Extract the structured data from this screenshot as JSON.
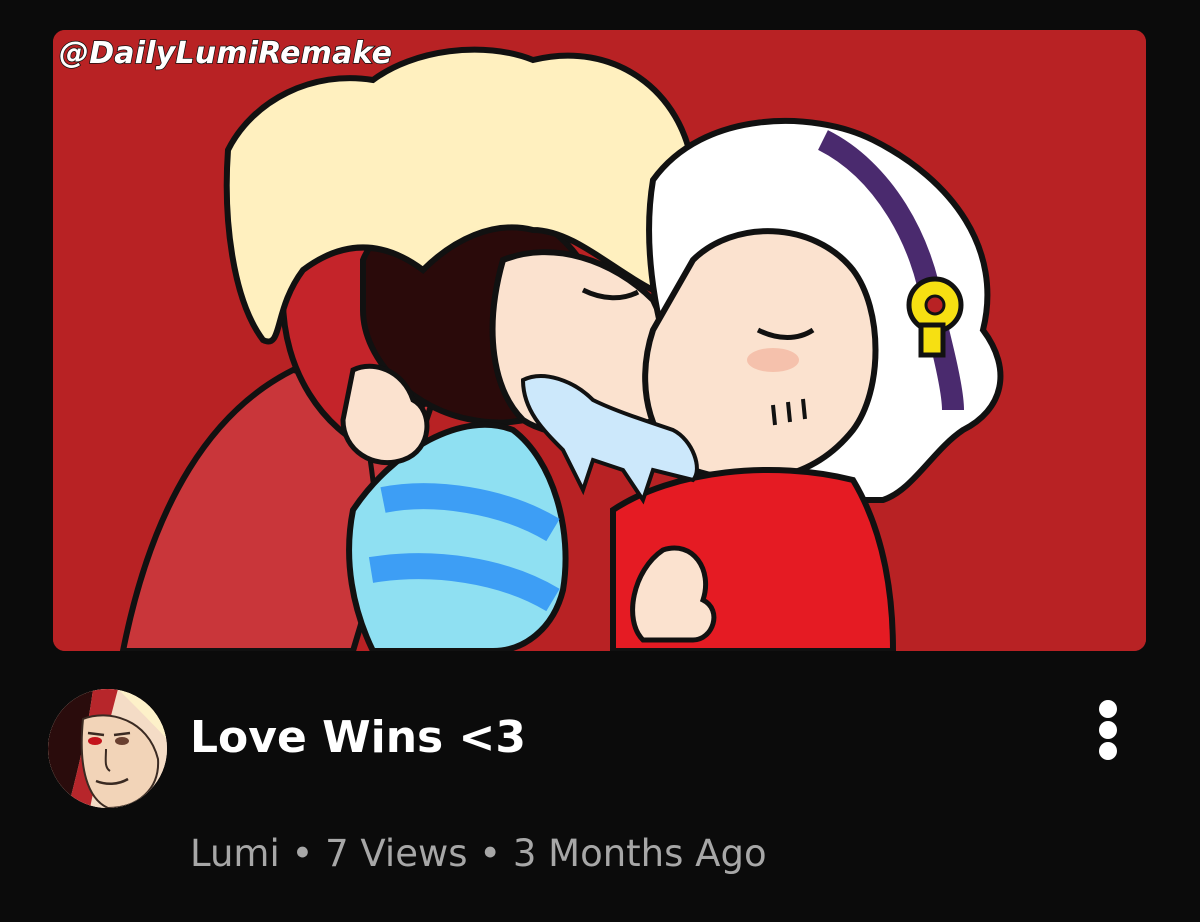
{
  "thumbnail": {
    "watermark": "@DailyLumiRemake",
    "background_color": "#b82224"
  },
  "video": {
    "title": "Love Wins <3",
    "channel": "Lumi",
    "views": "7 Views",
    "age": "3 Months Ago",
    "separator": "•"
  },
  "menu": {
    "icon": "kebab-menu-icon"
  },
  "avatar": {
    "icon": "channel-avatar"
  }
}
